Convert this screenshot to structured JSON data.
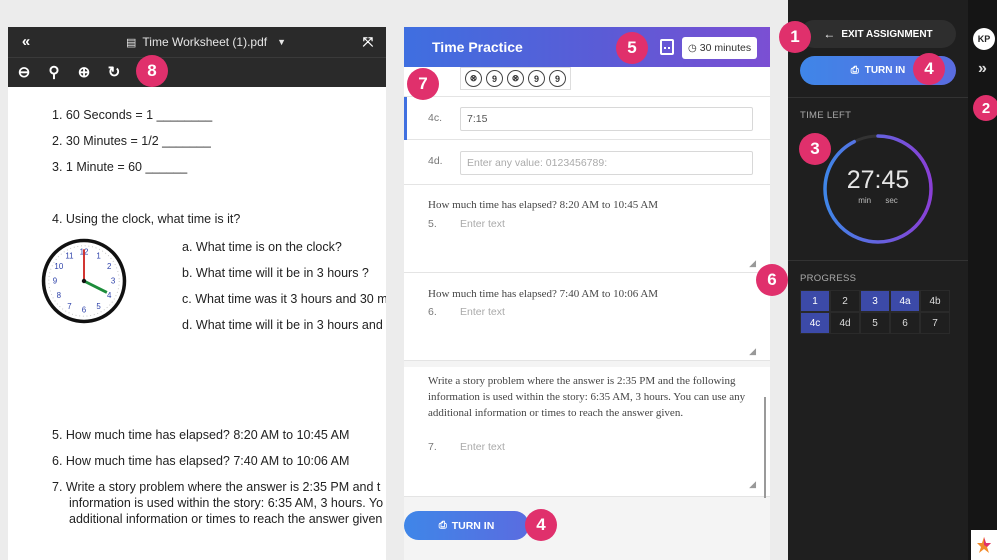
{
  "pdf_viewer": {
    "filename": "Time Worksheet (1).pdf",
    "questions": {
      "q1": "1.  60 Seconds = 1 ________",
      "q2": "2.  30 Minutes = 1/2 _______",
      "q3": "3.  1 Minute = 60 ______",
      "q4": "4.  Using the clock, what time is it?",
      "q4a": "a.  What time is on the clock?",
      "q4b": "b.  What time will it be in 3 hours ?",
      "q4c": "c.  What time was it 3 hours and 30 m",
      "q4d": "d.  What time will it be in 3 hours and",
      "q5": "5.  How much time has elapsed? 8:20 AM to 10:45 AM",
      "q6": "6.  How much time has elapsed? 7:40 AM to 10:06 AM",
      "q7_line1": "7.  Write a story problem where the answer is 2:35 PM and t",
      "q7_line2": "information is used within the story: 6:35 AM, 3 hours. Yo",
      "q7_line3": "additional information or times to reach the answer given"
    },
    "clock_numbers": [
      "12",
      "1",
      "2",
      "3",
      "4",
      "5",
      "6",
      "7",
      "8",
      "9",
      "10",
      "11"
    ]
  },
  "assignment": {
    "title": "Time Practice",
    "timer_chip": "30 minutes",
    "symbols": [
      "⊗",
      "9",
      "⊗",
      "9",
      "9"
    ],
    "items": [
      {
        "num": "4c.",
        "value": "7:15"
      },
      {
        "num": "4d.",
        "placeholder": "Enter any value: 0123456789:"
      },
      {
        "num": "5.",
        "question": "How much time has elapsed? 8:20 AM to 10:45 AM",
        "placeholder": "Enter text"
      },
      {
        "num": "6.",
        "question": "How much time has elapsed? 7:40 AM to 10:06 AM",
        "placeholder": "Enter text"
      },
      {
        "num": "7.",
        "question": "Write a story problem where the answer is 2:35 PM and the following information is used within the story: 6:35 AM, 3 hours. You can use any additional information or times to reach the answer given.",
        "placeholder": "Enter text"
      }
    ],
    "turn_in_label": "TURN IN"
  },
  "sidebar": {
    "exit_label": "EXIT ASSIGNMENT",
    "turn_in_label": "TURN IN",
    "time_left_label": "TIME LEFT",
    "timer_value": "27:45",
    "timer_min_label": "min",
    "timer_sec_label": "sec",
    "timer_fraction_remaining": 0.925,
    "progress_label": "PROGRESS",
    "progress_cells": [
      {
        "label": "1",
        "done": true
      },
      {
        "label": "2",
        "done": false
      },
      {
        "label": "3",
        "done": true
      },
      {
        "label": "4a",
        "done": true
      },
      {
        "label": "4b",
        "done": false
      },
      {
        "label": "4c",
        "done": true
      },
      {
        "label": "4d",
        "done": false
      },
      {
        "label": "5",
        "done": false
      },
      {
        "label": "6",
        "done": false
      },
      {
        "label": "7",
        "done": false
      }
    ],
    "avatar_initials": "KP"
  },
  "callouts": {
    "c1": "1",
    "c2": "2",
    "c3": "3",
    "c4a": "4",
    "c4b": "4",
    "c5": "5",
    "c6": "6",
    "c7": "7",
    "c8": "8"
  },
  "colors": {
    "callout": "#e0306c",
    "accent_blue": "#3f6fe0",
    "accent_purple": "#7b4fd3",
    "progress_done": "#3c4aa8"
  }
}
